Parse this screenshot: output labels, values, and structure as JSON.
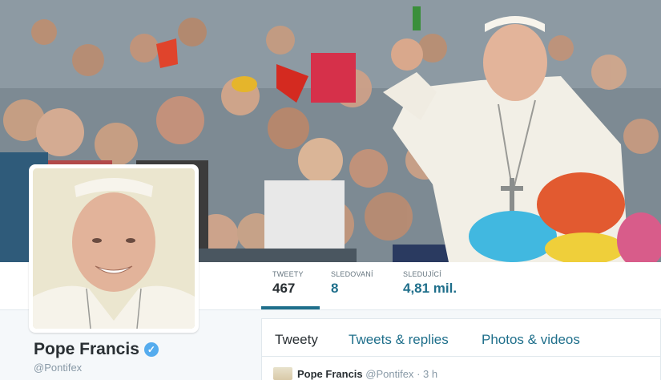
{
  "profile": {
    "name": "Pope Francis",
    "handle": "@Pontifex",
    "verified_icon": "verified-badge-icon"
  },
  "stats": [
    {
      "label": "TWEETY",
      "value": "467"
    },
    {
      "label": "SLEDOVANÍ",
      "value": "8"
    },
    {
      "label": "SLEDUJÍCÍ",
      "value": "4,81 mil."
    }
  ],
  "tabs": [
    {
      "label": "Tweety"
    },
    {
      "label": "Tweets & replies"
    },
    {
      "label": "Photos & videos"
    }
  ],
  "tweet": {
    "name": "Pope Francis",
    "handle": "@Pontifex",
    "separator": "·",
    "time": "3 h"
  },
  "colors": {
    "accent": "#1f6f8b",
    "background": "#f5f8fa",
    "verified": "#55acee"
  }
}
